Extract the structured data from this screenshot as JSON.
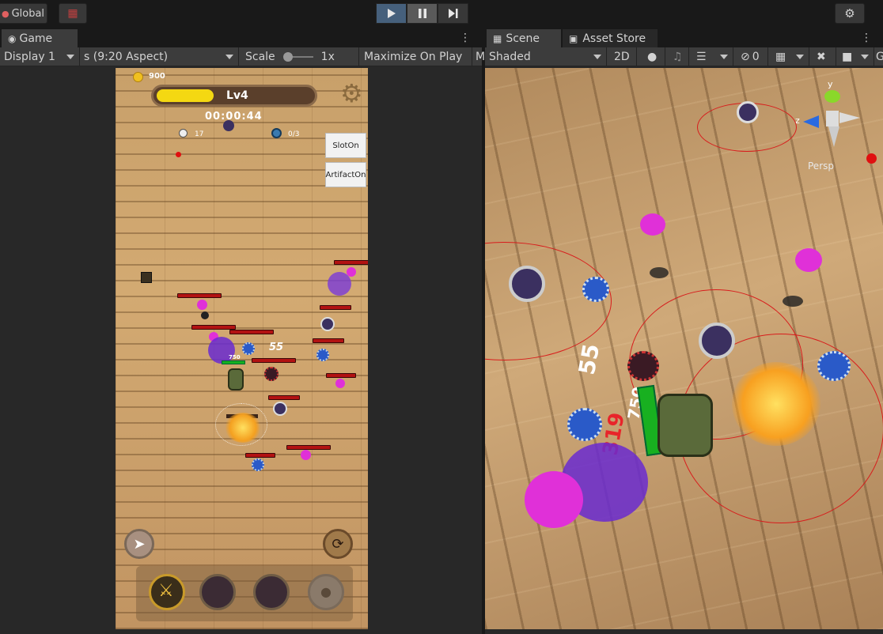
{
  "toolbar": {
    "global_label": "Global"
  },
  "game_panel": {
    "tab_label": "Game",
    "display": "Display 1",
    "aspect": "s (9:20 Aspect)",
    "scale_label": "Scale",
    "scale_value": "1x",
    "maximize": "Maximize On Play",
    "more": "M"
  },
  "game_hud": {
    "coins": "900",
    "level": "Lv4",
    "timer": "00:00:44",
    "kills": "17",
    "portal_count": "0/3",
    "slot_on": "SlotOn",
    "artifact_on": "ArtifactOn",
    "damage_number": "55",
    "player_hp": "750"
  },
  "scene_panel": {
    "tab_scene": "Scene",
    "tab_asset_store": "Asset Store",
    "shading": "Shaded",
    "mode_2d": "2D",
    "hidden_count": "0",
    "gizmo_more": "G",
    "persp": "Persp",
    "axis_y": "y",
    "axis_z": "z",
    "damage_a": "55",
    "damage_b": "750",
    "damage_c": "319"
  }
}
